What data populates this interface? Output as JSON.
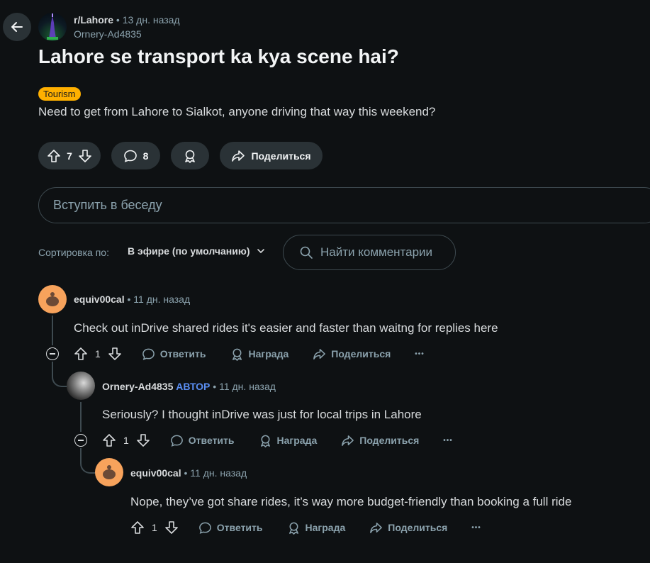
{
  "post": {
    "subreddit": "r/Lahore",
    "separator": "•",
    "time": "13 дн. назад",
    "author": "Ornery-Ad4835",
    "title": "Lahore se transport ka kya scene hai?",
    "flair": "Tourism",
    "body": "Need to get from Lahore to Sialkot, anyone driving that way this weekend?",
    "votes": "7",
    "comments": "8",
    "share_label": "Поделиться"
  },
  "reply_box": {
    "placeholder": "Вступить в беседу"
  },
  "sort": {
    "label": "Сортировка по:",
    "value": "В эфире (по умолчанию)"
  },
  "search": {
    "placeholder": "Найти комментарии"
  },
  "actions": {
    "reply": "Ответить",
    "award": "Награда",
    "share": "Поделиться",
    "more": "•••"
  },
  "comments": [
    {
      "username": "equiv00cal",
      "op_badge": "",
      "separator": "•",
      "time": "11 дн. назад",
      "text": "Check out inDrive shared rides it's easier and faster than waitng for replies here",
      "votes": "1"
    },
    {
      "username": "Ornery-Ad4835",
      "op_badge": "АВТОР",
      "separator": "•",
      "time": "11 дн. назад",
      "text": "Seriously? I thought inDrive was just for local trips in Lahore",
      "votes": "1"
    },
    {
      "username": "equiv00cal",
      "op_badge": "",
      "separator": "•",
      "time": "11 дн. назад",
      "text": "Nope, they’ve got share rides, it’s way more budget-friendly than booking a full ride",
      "votes": "1"
    }
  ],
  "colors": {
    "background": "#0e1113",
    "pill": "#2a3236",
    "flair": "#ffb000",
    "op_badge": "#5a8ef2",
    "avatar": "#f7a35c"
  }
}
